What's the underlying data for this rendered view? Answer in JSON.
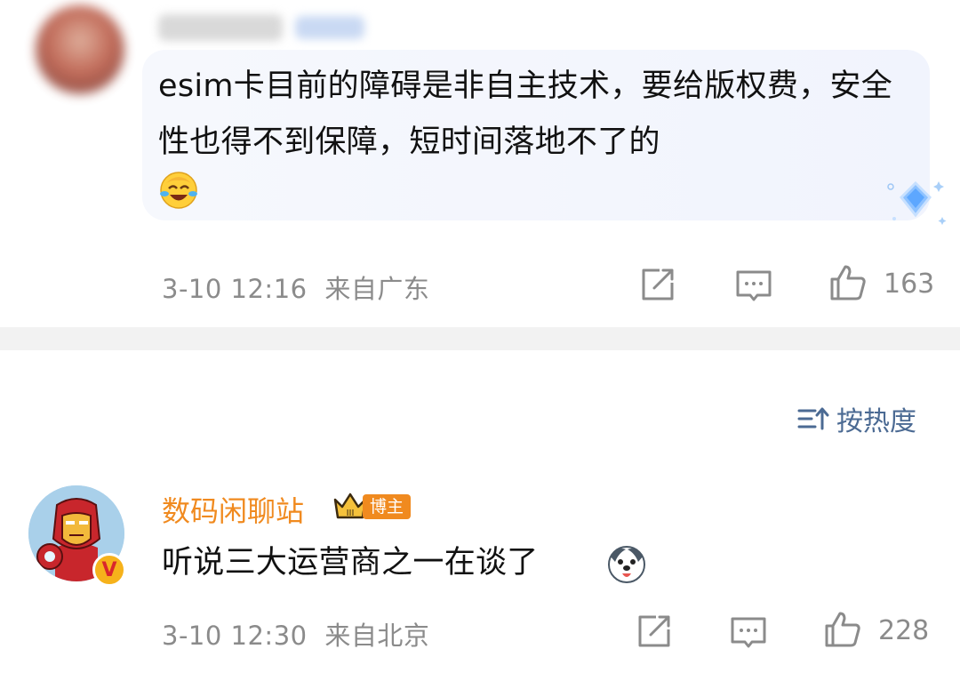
{
  "comment_top": {
    "text": "esim卡目前的障碍是非自主技术，要给版权费，安全性也得不到保障，短时间落地不了的",
    "emoji": "laugh-cry-emoji",
    "time": "3-10 12:16",
    "location": "来自广东",
    "likes": "163"
  },
  "sort": {
    "icon": "sort-icon",
    "label": "按热度"
  },
  "comment_second": {
    "author": "数码闲聊站",
    "badge": "博主",
    "text": "听说三大运营商之一在谈了",
    "emoji": "dog-emoji",
    "time": "3-10 12:30",
    "location": "来自北京",
    "likes": "228"
  },
  "colors": {
    "author": "#f08a1f",
    "meta": "#8b8b8b",
    "sort": "#4b6a93",
    "divider": "#f2f2f2"
  }
}
